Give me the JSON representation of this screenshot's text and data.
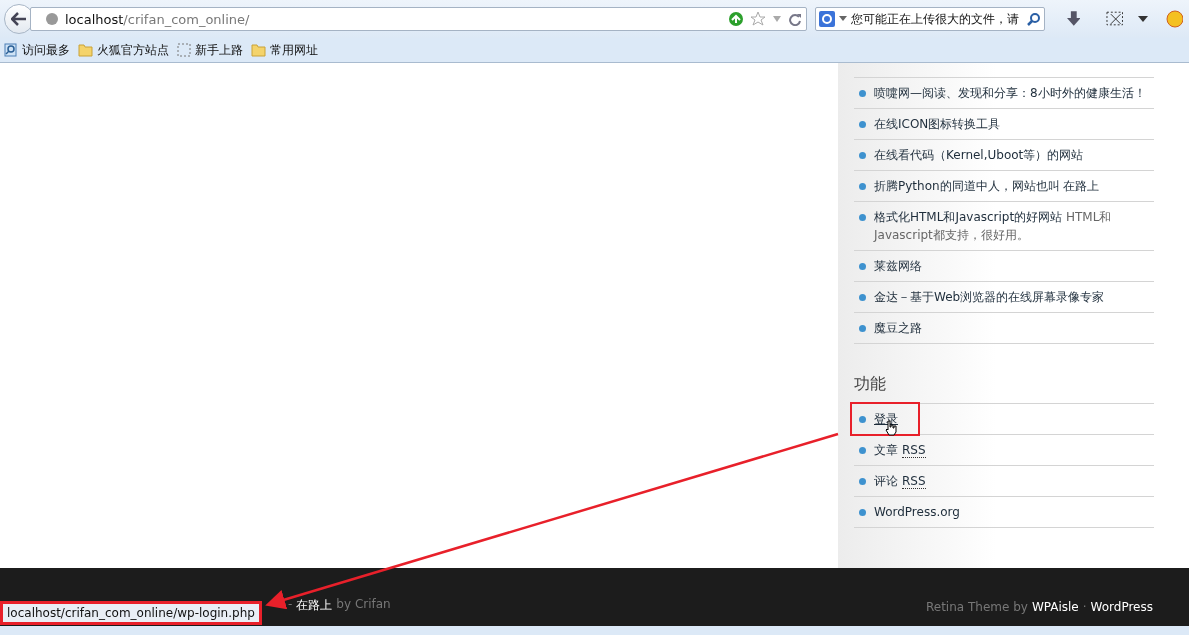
{
  "toolbar": {
    "address": {
      "host": "localhost",
      "path": "/crifan_com_online/"
    },
    "search": {
      "value": "您可能正在上传很大的文件，请"
    }
  },
  "bookmarks": [
    {
      "kind": "most-visited",
      "label": "访问最多"
    },
    {
      "kind": "folder",
      "label": "火狐官方站点"
    },
    {
      "kind": "page",
      "label": "新手上路"
    },
    {
      "kind": "folder",
      "label": "常用网址"
    }
  ],
  "sidebar": {
    "links": [
      {
        "title": "喷嚏网—阅读、发现和分享：8小时外的健康生活！"
      },
      {
        "title": "在线ICON图标转换工具"
      },
      {
        "title": "在线看代码（Kernel,Uboot等）的网站"
      },
      {
        "title": "折腾Python的同道中人，网站也叫 在路上"
      },
      {
        "title": "格式化HTML和Javascript的好网站",
        "description": "HTML和Javascript都支持，很好用。"
      },
      {
        "title": "莱兹网络"
      },
      {
        "title": "金达－基于Web浏览器的在线屏幕录像专家"
      },
      {
        "title": "魔豆之路"
      }
    ],
    "meta": {
      "heading": "功能",
      "items": [
        {
          "text": "登录",
          "hovered": true,
          "highlighted": true
        },
        {
          "text": "文章",
          "abbr": "RSS",
          "hovered": false,
          "highlighted": false
        },
        {
          "text": "评论",
          "abbr": "RSS",
          "hovered": false,
          "highlighted": false
        },
        {
          "text": "WordPress.org",
          "hovered": false,
          "highlighted": false
        }
      ]
    }
  },
  "footer": {
    "left": {
      "dash": "-",
      "site": "在路上",
      "author": "by Crifan"
    },
    "right": {
      "theme": "Retina Theme by",
      "theme_author": "WPAisle",
      "separator": "·",
      "platform": "WordPress"
    }
  },
  "status_url": "localhost/crifan_com_online/wp-login.php"
}
